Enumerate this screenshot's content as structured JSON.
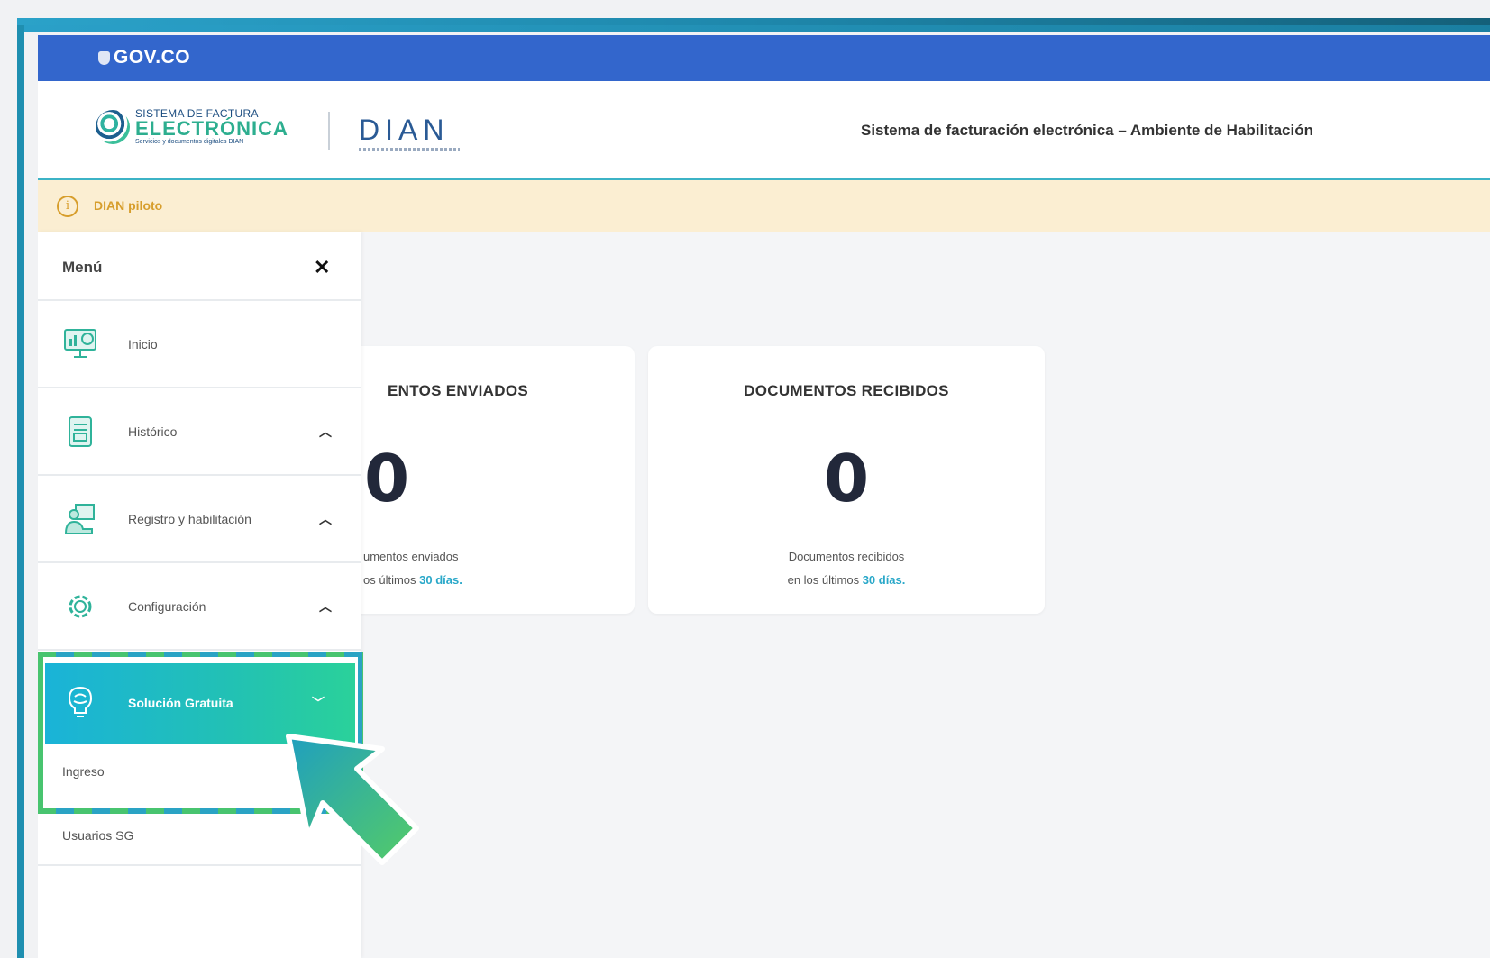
{
  "gov": {
    "logo": "GOV.CO"
  },
  "header": {
    "brand_line1": "SISTEMA DE FACTURA",
    "brand_line2": "ELECTRÓNICA",
    "brand_line3": "Servicios y documentos digitales DIAN",
    "dian": "DIAN",
    "title": "Sistema de facturación electrónica – Ambiente de Habilitación"
  },
  "notice": {
    "text": "DIAN piloto"
  },
  "menu": {
    "title": "Menú",
    "items": [
      {
        "label": "Inicio",
        "icon": "monitor-chart-icon"
      },
      {
        "label": "Histórico",
        "icon": "document-list-icon"
      },
      {
        "label": "Registro y habilitación",
        "icon": "person-board-icon"
      },
      {
        "label": "Configuración",
        "icon": "gear-icon"
      }
    ],
    "active": {
      "label": "Solución Gratuita",
      "icon": "brain-bulb-icon"
    },
    "sub_items": [
      "Ingreso",
      "Usuarios SG"
    ]
  },
  "cards": [
    {
      "title": "ENTOS ENVIADOS",
      "value": "0",
      "desc1": "umentos enviados",
      "desc2": "os últimos ",
      "desc_hl": "30 días."
    },
    {
      "title": "DOCUMENTOS RECIBIDOS",
      "value": "0",
      "desc1": "Documentos recibidos",
      "desc2": "en los últimos ",
      "desc_hl": "30 días."
    }
  ],
  "colors": {
    "gov_bar": "#3366cc",
    "active_start": "#1ab3d8",
    "active_end": "#2ad19a",
    "pilot_bg": "#fbeed2",
    "pilot_text": "#d79e2c"
  }
}
